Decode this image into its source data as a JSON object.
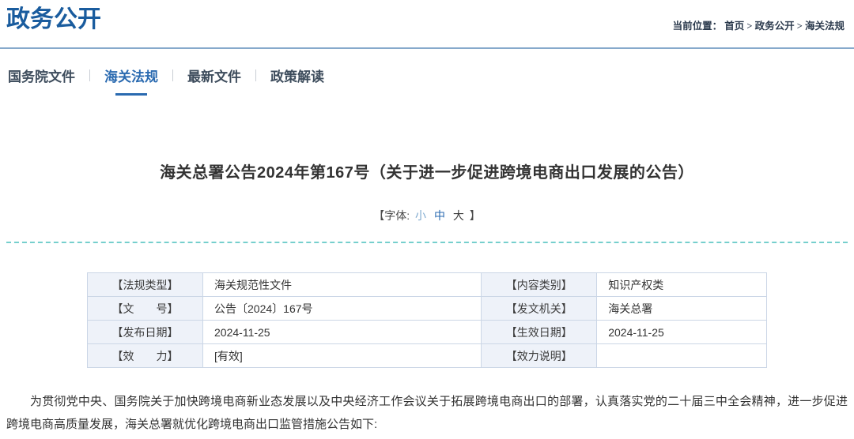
{
  "header": {
    "section_title": "政务公开",
    "breadcrumb": {
      "prefix": "当前位置：",
      "items": [
        "首页",
        "政务公开",
        "海关法规"
      ],
      "separator": " > "
    }
  },
  "tabs": [
    {
      "label": "国务院文件",
      "active": false
    },
    {
      "label": "海关法规",
      "active": true
    },
    {
      "label": "最新文件",
      "active": false
    },
    {
      "label": "政策解读",
      "active": false
    }
  ],
  "article": {
    "title": "海关总署公告2024年第167号（关于进一步促进跨境电商出口发展的公告）",
    "font_selector": {
      "prefix": "【字体:",
      "small": "小",
      "medium": "中",
      "large": "大",
      "suffix": "】"
    },
    "meta": {
      "row1": {
        "label1": "【法规类型】",
        "value1": "海关规范性文件",
        "label2": "【内容类别】",
        "value2": "知识产权类"
      },
      "row2": {
        "label1": "【文　　号】",
        "value1": "公告〔2024〕167号",
        "label2": "【发文机关】",
        "value2": "海关总署"
      },
      "row3": {
        "label1": "【发布日期】",
        "value1": "2024-11-25",
        "label2": "【生效日期】",
        "value2": "2024-11-25"
      },
      "row4": {
        "label1": "【效　　力】",
        "value1": "[有效]",
        "label2": "【效力说明】",
        "value2": ""
      }
    },
    "body": "为贯彻党中央、国务院关于加快跨境电商新业态发展以及中央经济工作会议关于拓展跨境电商出口的部署，认真落实党的二十届三中全会精神，进一步促进跨境电商高质量发展，海关总署就优化跨境电商出口监管措施公告如下:"
  },
  "colors": {
    "section_title": "#1a5c9e",
    "header_rule": "#86a9cb",
    "tab_active": "#2a6ab0",
    "tab_inactive": "#3d4c5c",
    "dotted_rule": "#76cfcd",
    "table_label_bg": "#eef2f9",
    "table_border": "#cbd6e6",
    "body_text": "#333333"
  }
}
